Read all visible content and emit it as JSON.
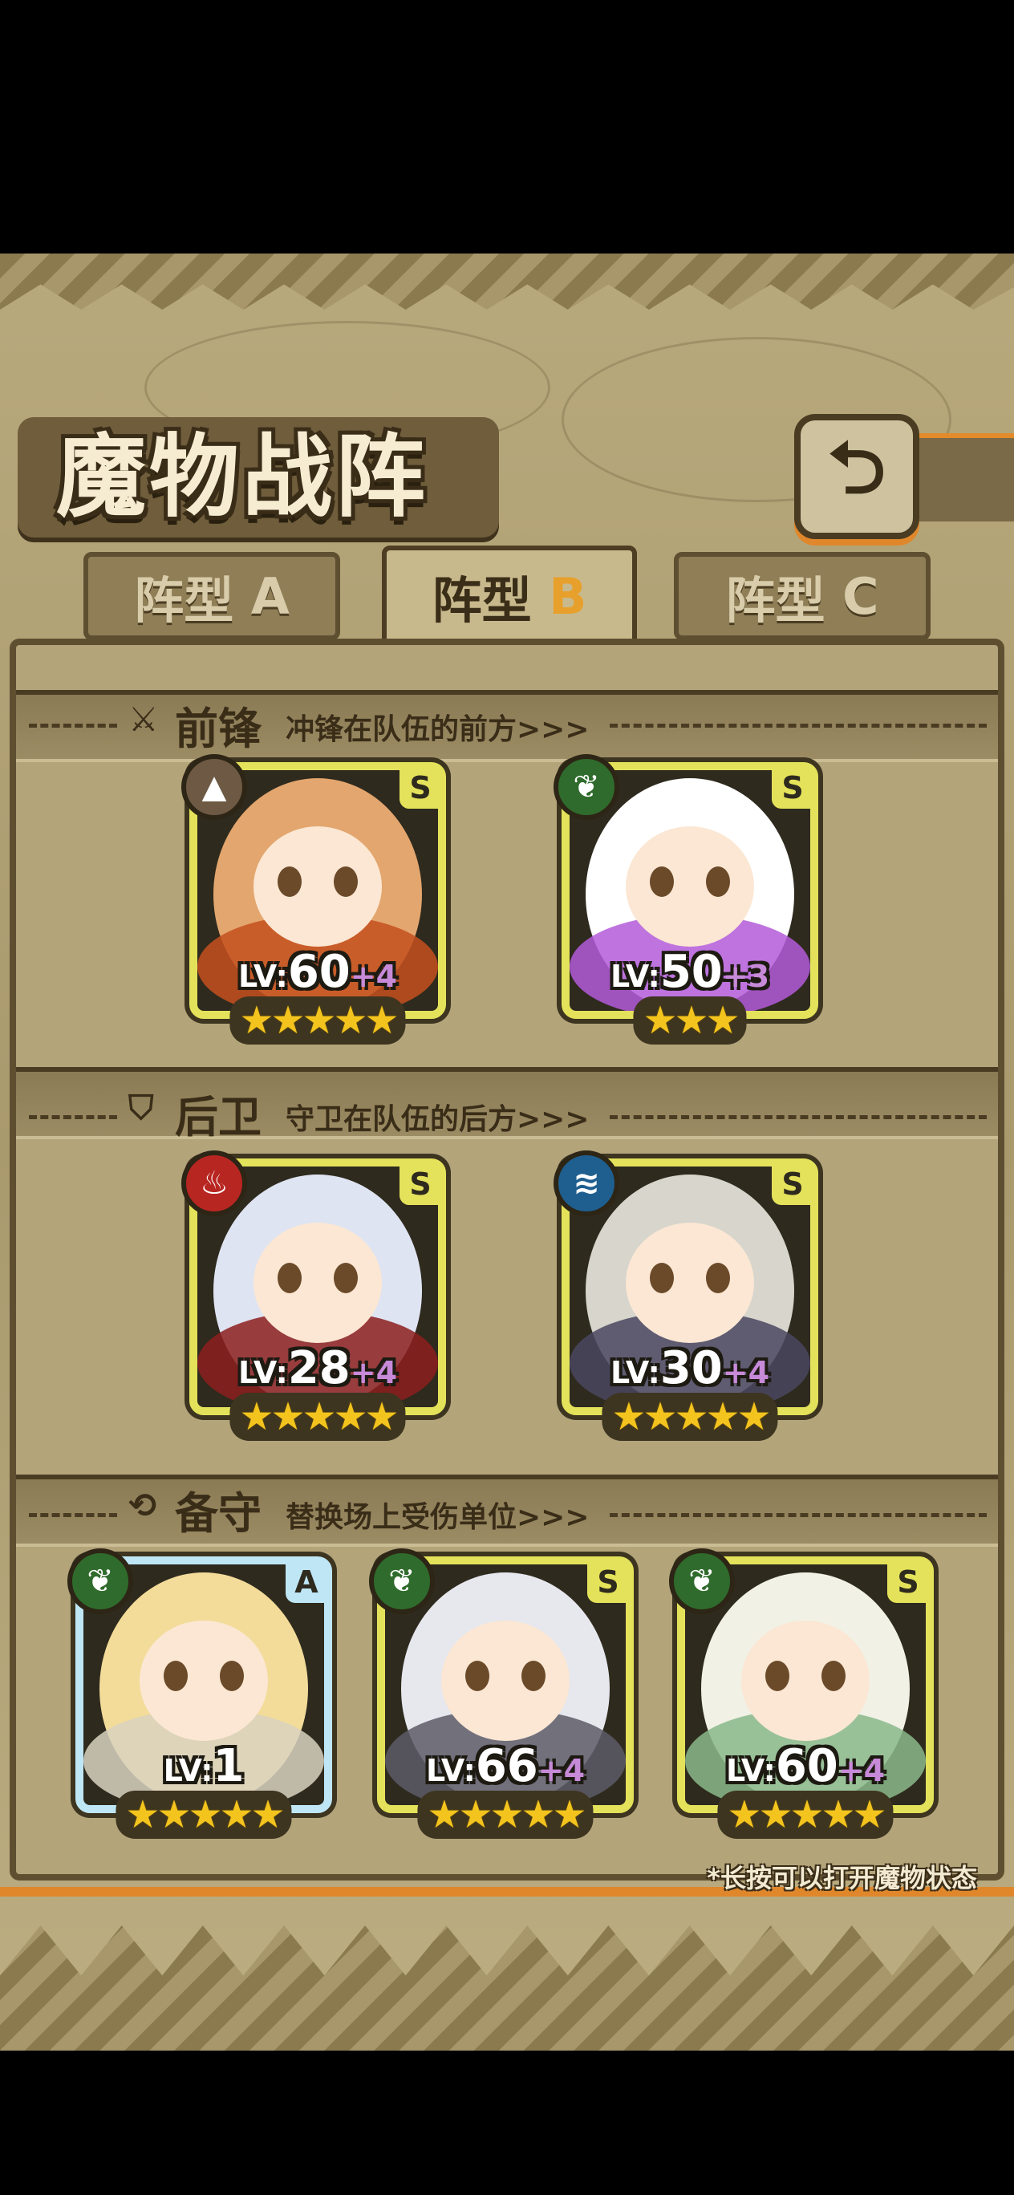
{
  "header": {
    "title": "魔物战阵",
    "back_icon": "return-icon"
  },
  "tabs": [
    {
      "label": "阵型",
      "letter": "A",
      "active": false
    },
    {
      "label": "阵型",
      "letter": "B",
      "active": true
    },
    {
      "label": "阵型",
      "letter": "C",
      "active": false
    }
  ],
  "sections": {
    "front": {
      "title": "前锋",
      "desc": "冲锋在队伍的前方>>>",
      "icon": "sword-icon"
    },
    "rear": {
      "title": "后卫",
      "desc": "守卫在队伍的后方>>>",
      "icon": "shield-icon"
    },
    "reserve": {
      "title": "备守",
      "desc": "替换场上受伤单位>>>",
      "icon": "swap-icon"
    }
  },
  "units": [
    {
      "lv_label": "LV:",
      "level": "60",
      "plus": "+4",
      "rank": "S",
      "element": "earth",
      "element_color": "#6e5a44",
      "stars": "★★★★★",
      "hair": "#e3a66e",
      "accent": "#c4501f"
    },
    {
      "lv_label": "LV:",
      "level": "50",
      "plus": "+3",
      "rank": "S",
      "element": "nature",
      "element_color": "#2f6b2c",
      "stars": "★★★",
      "hair": "#ffffff",
      "accent": "#b35bd9"
    },
    {
      "lv_label": "LV:",
      "level": "28",
      "plus": "+4",
      "rank": "S",
      "element": "fire",
      "element_color": "#b82622",
      "stars": "★★★★★",
      "hair": "#dfe4f2",
      "accent": "#8c1e1e"
    },
    {
      "lv_label": "LV:",
      "level": "30",
      "plus": "+4",
      "rank": "S",
      "element": "water",
      "element_color": "#1f5f8f",
      "stars": "★★★★★",
      "hair": "#d7d5cc",
      "accent": "#4a4660"
    },
    {
      "lv_label": "LV:",
      "level": "1",
      "plus": "",
      "rank": "A",
      "element": "nature",
      "element_color": "#2f6b2c",
      "stars": "★★★★★",
      "hair": "#f3dc9a",
      "accent": "#d8d2c0"
    },
    {
      "lv_label": "LV:",
      "level": "66",
      "plus": "+4",
      "rank": "S",
      "element": "nature",
      "element_color": "#2f6b2c",
      "stars": "★★★★★",
      "hair": "#e7e7ee",
      "accent": "#5c5a66"
    },
    {
      "lv_label": "LV:",
      "level": "60",
      "plus": "+4",
      "rank": "S",
      "element": "nature",
      "element_color": "#2f6b2c",
      "stars": "★★★★★",
      "hair": "#f1f1e6",
      "accent": "#8ab88a"
    }
  ],
  "hint": "*长按可以打开魔物状态"
}
